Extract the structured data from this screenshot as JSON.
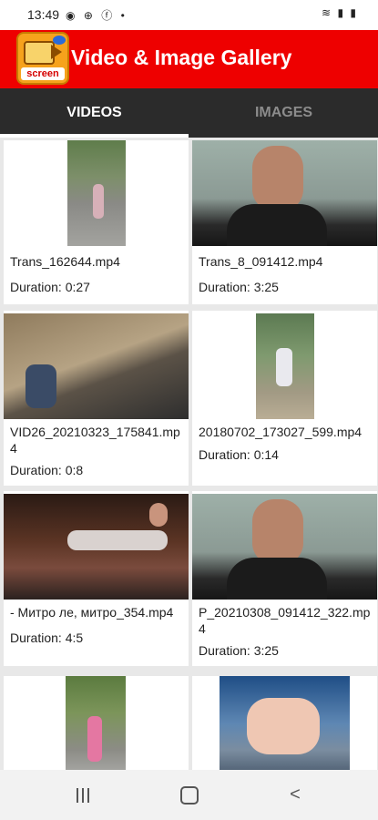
{
  "status_bar": {
    "time": "13:49",
    "left_icons": [
      "signal-dot-icon",
      "app-icon",
      "facebook-icon"
    ],
    "right_icons": [
      "wifi-icon",
      "signal-icon",
      "battery-icon"
    ]
  },
  "app_bar": {
    "title": "Video & Image Gallery",
    "logo_text": "screen"
  },
  "tabs": [
    {
      "label": "VIDEOS",
      "selected": true
    },
    {
      "label": "IMAGES",
      "selected": false
    }
  ],
  "videos": [
    {
      "name": "Trans_162644.mp4",
      "duration": "Duration: 0:27"
    },
    {
      "name": "Trans_8_091412.mp4",
      "duration": "Duration: 3:25"
    },
    {
      "name": "VID26_20210323_175841.mp4",
      "duration": "Duration: 0:8"
    },
    {
      "name": "20180702_173027_599.mp4",
      "duration": "Duration: 0:14"
    },
    {
      "name": "- Митро ле, митро_354.mp4",
      "duration": "Duration: 4:5"
    },
    {
      "name": "P_20210308_091412_322.mp4",
      "duration": "Duration: 3:25"
    },
    {
      "name": "",
      "duration": ""
    },
    {
      "name": "",
      "duration": ""
    }
  ],
  "nav": {
    "buttons": [
      "recent-apps",
      "home",
      "back"
    ]
  },
  "colors": {
    "app_bar": "#ee0000",
    "tab_bar": "#2b2b2b",
    "tab_selected": "#ffffff",
    "tab_unselected": "#8c8c8c"
  }
}
